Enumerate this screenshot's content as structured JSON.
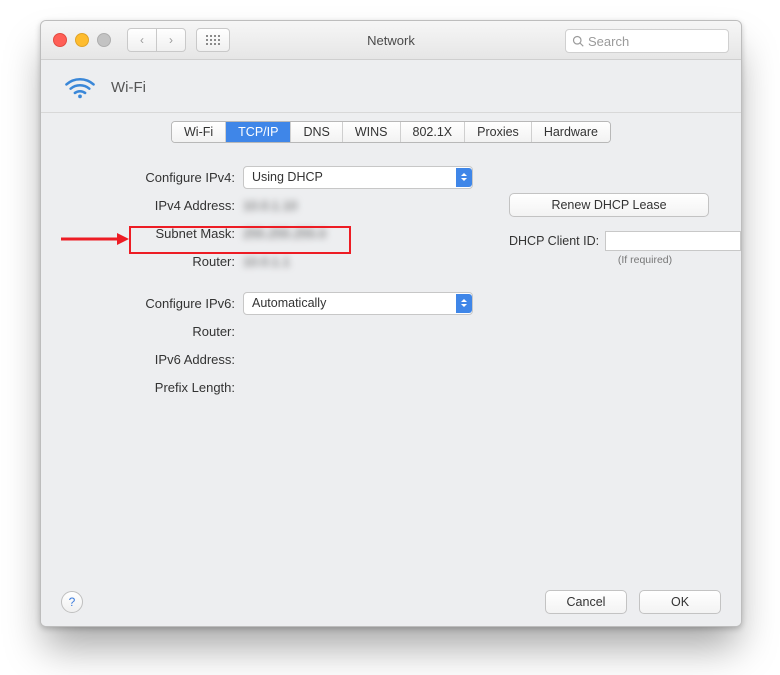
{
  "window": {
    "title": "Network"
  },
  "search": {
    "placeholder": "Search"
  },
  "header": {
    "interface": "Wi-Fi"
  },
  "tabs": [
    "Wi-Fi",
    "TCP/IP",
    "DNS",
    "WINS",
    "802.1X",
    "Proxies",
    "Hardware"
  ],
  "active_tab": "TCP/IP",
  "form": {
    "configure_ipv4_label": "Configure IPv4:",
    "configure_ipv4_value": "Using DHCP",
    "ipv4_address_label": "IPv4 Address:",
    "ipv4_address_value": "10.0.1.10",
    "subnet_mask_label": "Subnet Mask:",
    "subnet_mask_value": "255.255.255.0",
    "router_label": "Router:",
    "router_value": "10.0.1.1",
    "configure_ipv6_label": "Configure IPv6:",
    "configure_ipv6_value": "Automatically",
    "router_v6_label": "Router:",
    "ipv6_address_label": "IPv6 Address:",
    "prefix_length_label": "Prefix Length:"
  },
  "side": {
    "renew_button": "Renew DHCP Lease",
    "dhcp_client_id_label": "DHCP Client ID:",
    "dhcp_client_id_value": "",
    "if_required": "(If required)"
  },
  "footer": {
    "help": "?",
    "cancel": "Cancel",
    "ok": "OK"
  }
}
